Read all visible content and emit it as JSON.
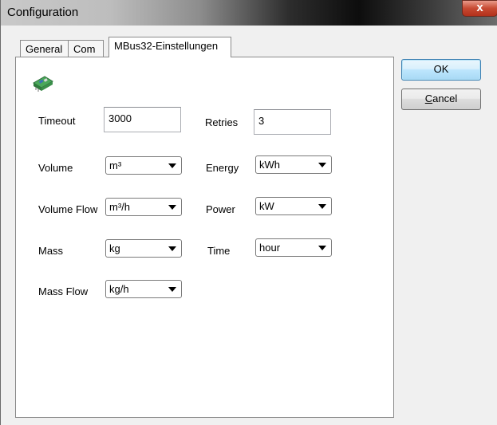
{
  "window": {
    "title": "Configuration",
    "close_glyph": "x"
  },
  "tabs": [
    {
      "label": "General"
    },
    {
      "label": "Com"
    },
    {
      "label": "MBus32-Einstellungen"
    }
  ],
  "buttons": {
    "ok": "OK",
    "cancel_first": "C",
    "cancel_rest": "ancel"
  },
  "fields": {
    "timeout": {
      "label": "Timeout",
      "value": "3000"
    },
    "retries": {
      "label": "Retries",
      "value": "3"
    }
  },
  "units": {
    "volume": {
      "label": "Volume",
      "selected": "m³"
    },
    "energy": {
      "label": "Energy",
      "selected": "kWh"
    },
    "volume_flow": {
      "label": "Volume Flow",
      "selected": "m³/h"
    },
    "power": {
      "label": "Power",
      "selected": "kW"
    },
    "mass": {
      "label": "Mass",
      "selected": "kg"
    },
    "time": {
      "label": "Time",
      "selected": "hour"
    },
    "mass_flow": {
      "label": "Mass Flow",
      "selected": "kg/h"
    }
  },
  "icons": {
    "device": "circuit-board-icon"
  }
}
